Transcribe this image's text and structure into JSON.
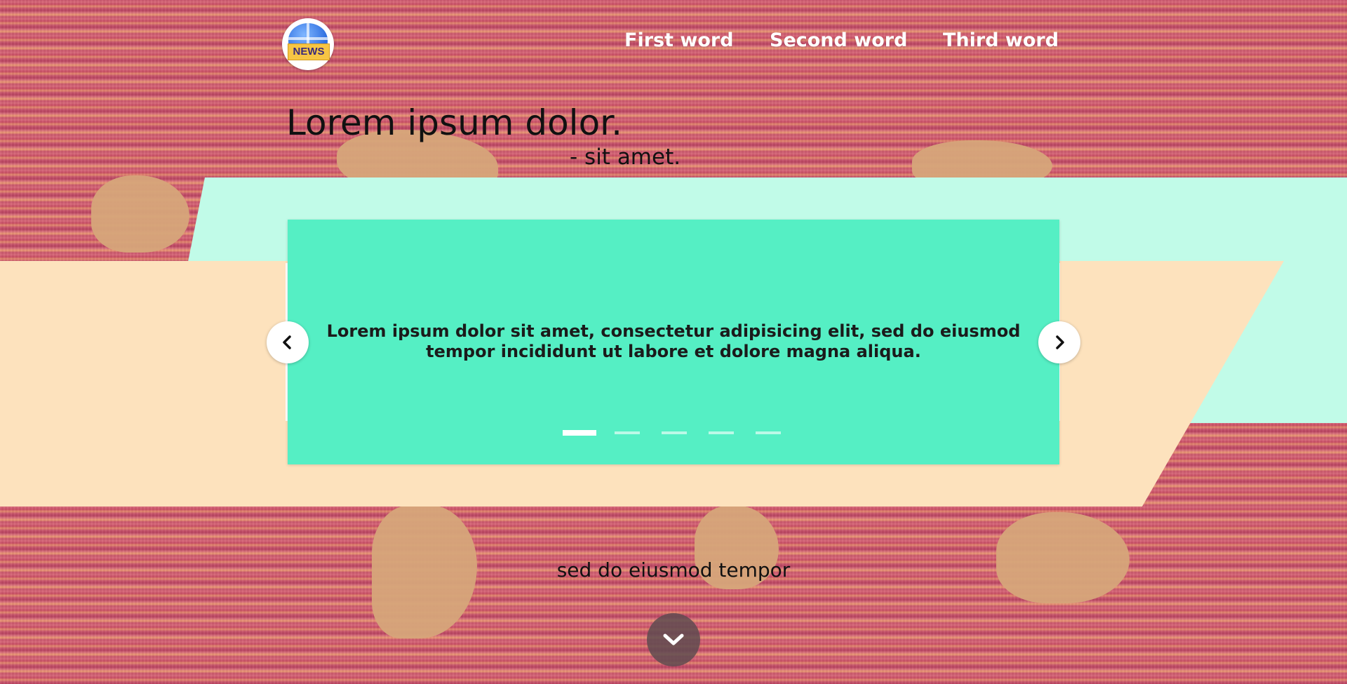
{
  "header": {
    "logo_text": "NEWS",
    "nav": [
      {
        "label": "First word"
      },
      {
        "label": "Second word"
      },
      {
        "label": "Third word"
      }
    ]
  },
  "hero": {
    "title": "Lorem ipsum dolor.",
    "subtitle": "- sit amet."
  },
  "carousel": {
    "text_line1": "Lorem ipsum dolor sit amet, consectetur adipisicing elit, sed do eiusmod",
    "text_line2": "tempor incididunt ut labore et dolore magna aliqua.",
    "prev_icon": "chevron-left-icon",
    "next_icon": "chevron-right-icon",
    "slide_count": 5,
    "active_index": 0,
    "colors": {
      "slide": "#55efc4",
      "mint_band": "#c1fbe8",
      "peach_band": "#fde2bd"
    }
  },
  "footer": {
    "tagline": "sed do eiusmod tempor",
    "scroll_icon": "chevron-down-icon"
  }
}
